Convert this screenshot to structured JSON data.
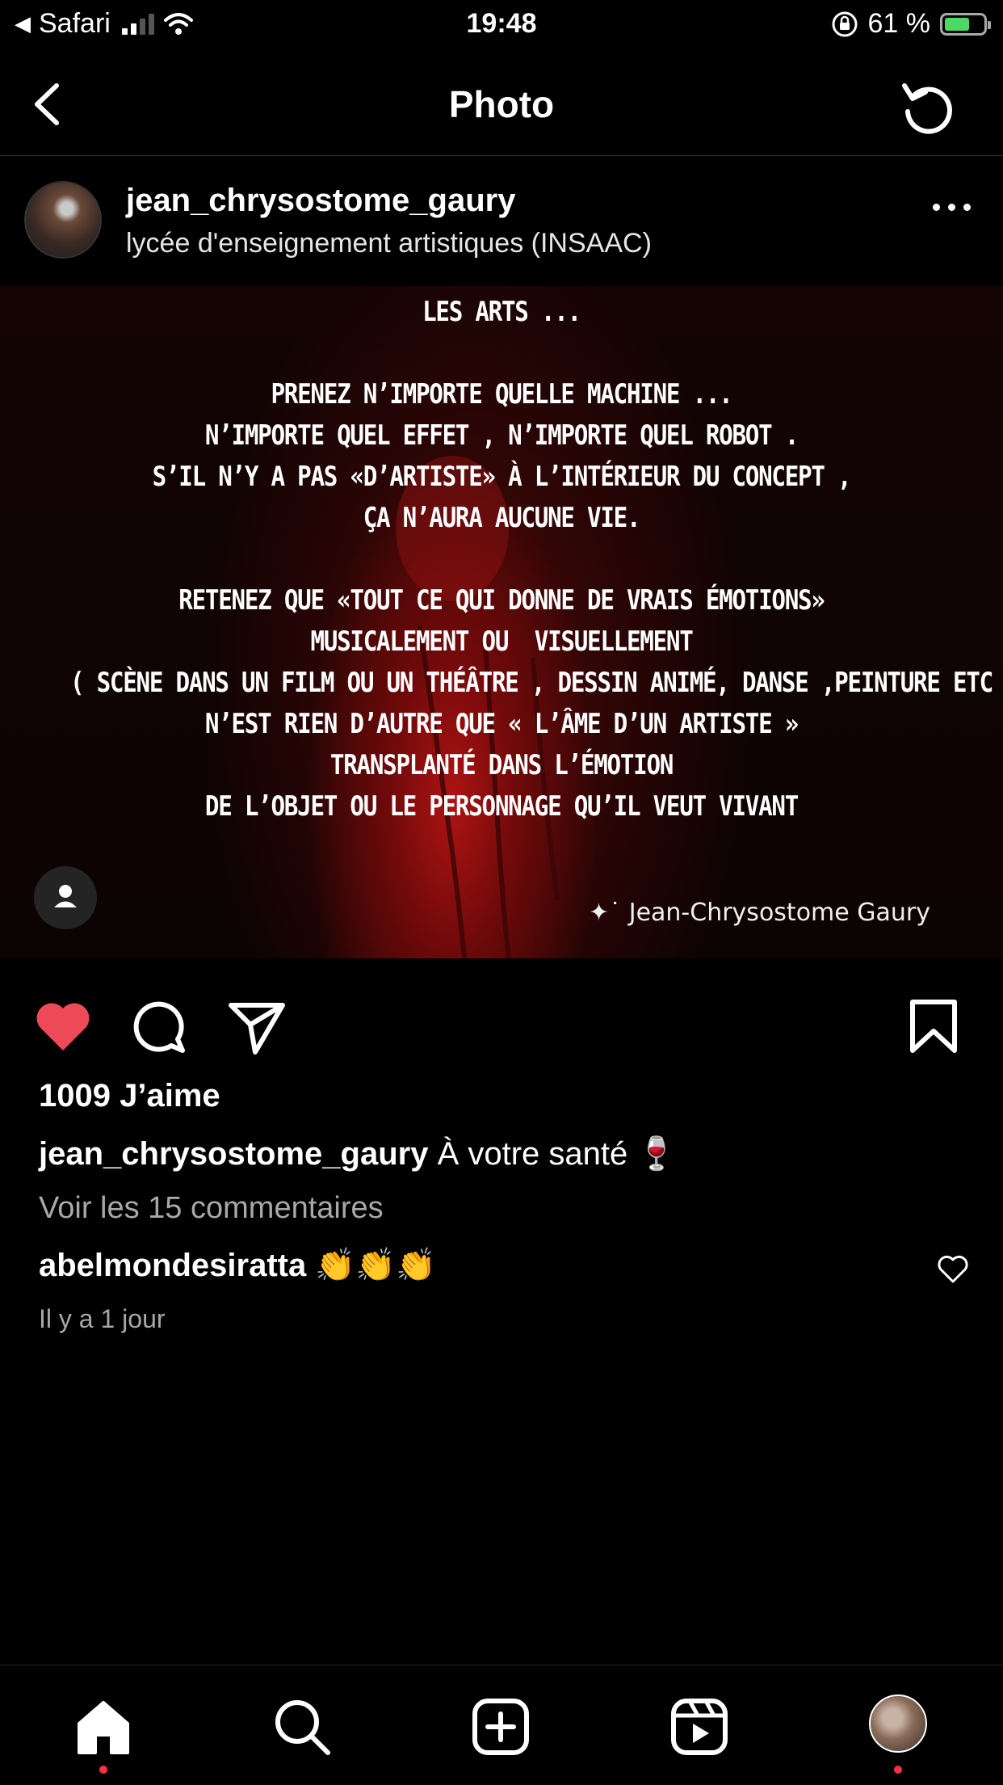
{
  "status_bar": {
    "back_app": "Safari",
    "time": "19:48",
    "battery": "61 %"
  },
  "nav": {
    "title": "Photo"
  },
  "post": {
    "username": "jean_chrysostome_gaury",
    "location": "lycée d'enseignement artistiques (INSAAC)"
  },
  "poster": {
    "lines": [
      "LES ARTS ...",
      "",
      "PRENEZ N’IMPORTE QUELLE MACHINE ...",
      "N’IMPORTE QUEL EFFET , N’IMPORTE QUEL ROBOT .",
      "S’IL N’Y A PAS «D’ARTISTE» À L’INTÉRIEUR DU CONCEPT ,",
      "ÇA N’AURA AUCUNE VIE.",
      "",
      "RETENEZ QUE «TOUT CE QUI DONNE DE VRAIS ÉMOTIONS»",
      "MUSICALEMENT OU  VISUELLEMENT",
      "( SCÈNE DANS UN FILM OU UN THÉÂTRE , DESSIN ANIMÉ, DANSE ,PEINTURE ETC )",
      "N’EST RIEN D’AUTRE QUE « L’ÂME D’UN ARTISTE »",
      "TRANSPLANTÉ DANS L’ÉMOTION",
      "DE L’OBJET OU LE PERSONNAGE QU’IL VEUT VIVANT"
    ],
    "signature": "Jean-Chrysostome Gaury"
  },
  "engagement": {
    "likes": "1009 J’aime",
    "caption_user": "jean_chrysostome_gaury",
    "caption_text": "À votre santé 🍷",
    "view_comments": "Voir les 15 commentaires",
    "comment_user": "abelmondesiratta",
    "comment_text": "👏👏👏",
    "time_ago": "Il y a 1 jour"
  },
  "colors": {
    "background": "#000000",
    "like_red": "#ed4956",
    "muted_text": "#a8a8a8",
    "notification_dot": "#ff3040"
  },
  "icons": [
    "back-icon",
    "refresh-icon",
    "more-icon",
    "user-tag-icon",
    "heart-icon",
    "comment-icon",
    "share-icon",
    "bookmark-icon",
    "home-icon",
    "search-icon",
    "create-icon",
    "reels-icon"
  ]
}
